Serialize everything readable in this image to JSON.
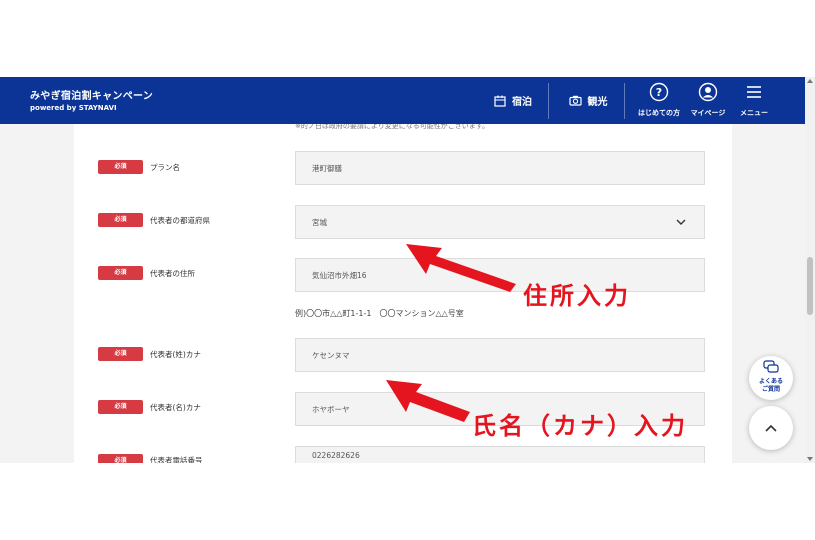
{
  "header": {
    "title": "みやぎ宿泊割キャンペーン",
    "subtitle": "powered by STAYNAVI",
    "nav": [
      {
        "label": "宿泊",
        "icon": "calendar-icon"
      },
      {
        "label": "観光",
        "icon": "camera-icon"
      }
    ],
    "icons": [
      {
        "label": "はじめての方",
        "icon": "question-icon"
      },
      {
        "label": "マイページ",
        "icon": "user-icon"
      },
      {
        "label": "メニュー",
        "icon": "hamburger-icon"
      }
    ],
    "bg_color": "#0b3496"
  },
  "form": {
    "notice": "※的ノ日は政府の要請により変更になる可能性がございます。",
    "required_label": "必須",
    "rows": [
      {
        "label": "プラン名",
        "value": "港町御膳"
      },
      {
        "label": "代表者の都道府県",
        "value": "宮城"
      },
      {
        "label": "代表者の住所",
        "value": "気仙沼市外畑16"
      },
      {
        "label": "代表者(姓)カナ",
        "value": "ケセンヌマ"
      },
      {
        "label": "代表者(名)カナ",
        "value": "ホヤボーヤ"
      },
      {
        "label": "代表者電話番号",
        "value": "0226282626"
      }
    ],
    "address_hint": "例)〇〇市△△町1-1-1　〇〇マンション△△号室",
    "badge_color": "#d63b44"
  },
  "annotations": {
    "address": "住所入力",
    "name": "氏名（カナ）入力",
    "color": "#e4151f"
  },
  "fab": {
    "faq_line1": "よくある",
    "faq_line2": "ご質問"
  }
}
